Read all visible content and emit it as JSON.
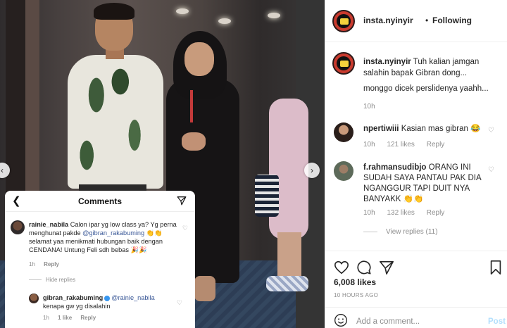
{
  "post": {
    "username": "insta.nyinyir",
    "follow_status": "Following",
    "caption_line1": "Tuh kalian jamgan salahin bapak Gibran dong...",
    "caption_line2": "monggo dicek perslidenya yaahh...",
    "caption_time": "10h",
    "likes": "6,008 likes",
    "posted_ago": "10 HOURS AGO",
    "add_comment_placeholder": "Add a comment...",
    "post_label": "Post"
  },
  "comments": [
    {
      "user": "npertiwiii",
      "text": "Kasian mas gibran 😂",
      "time": "10h",
      "likes": "121 likes",
      "reply": "Reply"
    },
    {
      "user": "f.rahmansudibjo",
      "text": "ORANG INI SUDAH SAYA PANTAU PAK DIA NGANGGUR TAPI DUIT NYA BANYAKK 👏👏",
      "time": "10h",
      "likes": "132 likes",
      "reply": "Reply",
      "view_replies": "View replies (11)"
    }
  ],
  "embedded": {
    "title": "Comments",
    "comment1": {
      "user": "rainie_nabila",
      "text_a": "Calon ipar yg low class ya? Yg perna menghunat pakde ",
      "mention": "@gibran_rakabuming",
      "text_b": "👏👏 selamat yaa menikmati hubungan baik dengan CENDANA! Untung  Feli sdh bebas 🎉🎉",
      "time": "1h",
      "reply": "Reply"
    },
    "hide_replies": "Hide replies",
    "comment2": {
      "user": "gibran_rakabuming",
      "mention": "@rainie_nabila",
      "text": "kenapa gw yg disalahin",
      "time": "1h",
      "likes": "1 like",
      "reply": "Reply"
    }
  },
  "colors": {
    "accent_link": "#3b5998",
    "verified": "#3897f0",
    "post_button": "#b2dffc",
    "meta_gray": "#8e8e8e"
  }
}
